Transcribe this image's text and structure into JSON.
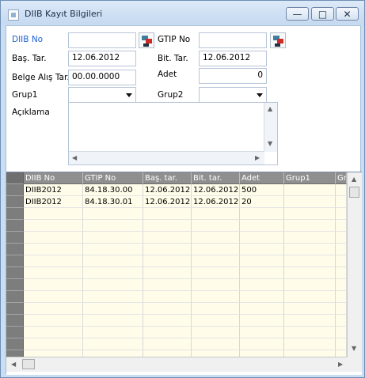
{
  "window": {
    "title": "DIIB Kayıt Bilgileri",
    "min_glyph": "—",
    "max_glyph": "□",
    "close_glyph": "✕"
  },
  "form": {
    "diib_no": {
      "label": "DIIB No",
      "value": ""
    },
    "gtip_no": {
      "label": "GTIP No",
      "value": ""
    },
    "bas_tar": {
      "label": "Baş. Tar.",
      "value": "12.06.2012"
    },
    "bit_tar": {
      "label": "Bit. Tar.",
      "value": "12.06.2012"
    },
    "belge_alis_tar": {
      "label": "Belge Alış Tar.",
      "value": "00.00.0000"
    },
    "adet": {
      "label": "Adet",
      "value": "0"
    },
    "grup1": {
      "label": "Grup1",
      "value": ""
    },
    "grup2": {
      "label": "Grup2",
      "value": ""
    },
    "aciklama": {
      "label": "Açıklama",
      "value": ""
    }
  },
  "grid": {
    "columns": [
      "DIIB No",
      "GTIP No",
      "Baş. tar.",
      "Bit. tar.",
      "Adet",
      "Grup1",
      "Gr"
    ],
    "rows": [
      [
        "DIIB2012",
        "84.18.30.00",
        "12.06.2012",
        "12.06.2012",
        "500",
        "",
        ""
      ],
      [
        "DIIB2012",
        "84.18.30.01",
        "12.06.2012",
        "12.06.2012",
        "20",
        "",
        ""
      ]
    ]
  },
  "icons": {
    "lookup": "lookup-icon",
    "combo": "chevron-down-icon",
    "scroll_up": "▲",
    "scroll_down": "▼",
    "scroll_left": "◀",
    "scroll_right": "▶"
  }
}
